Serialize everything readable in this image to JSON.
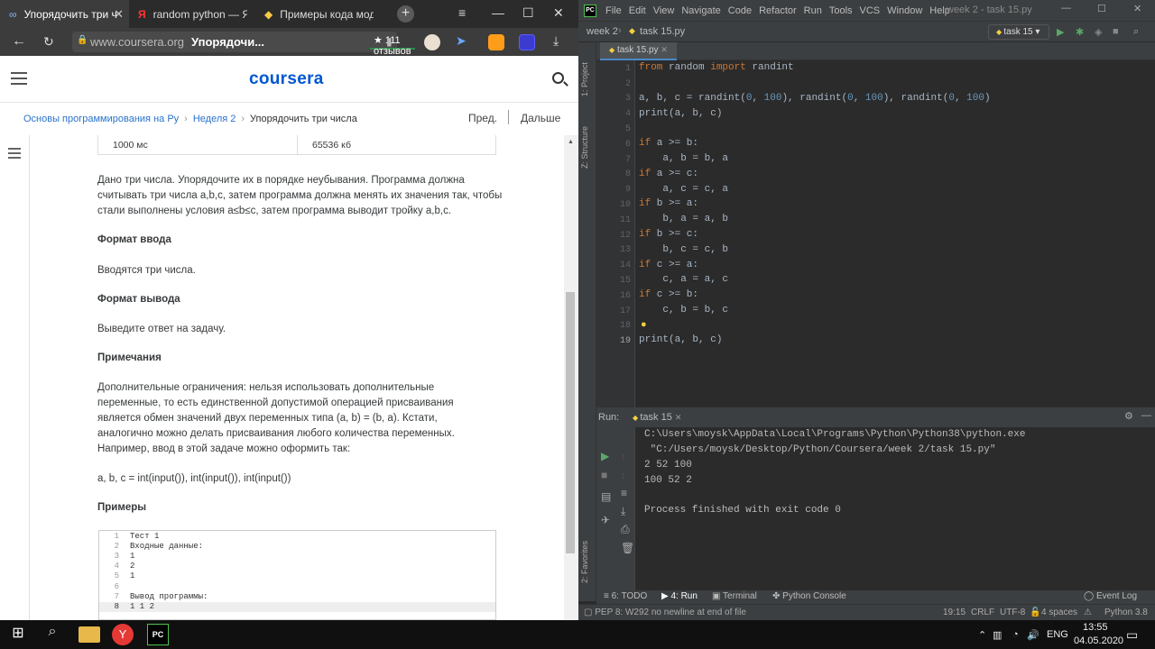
{
  "browser": {
    "tabs": [
      {
        "title": "Упорядочить три ч",
        "icon": "coursera-icon"
      },
      {
        "title": "random python — Янд",
        "icon": "yandex-icon"
      },
      {
        "title": "Примеры кода модул",
        "icon": "python-icon"
      }
    ],
    "address": {
      "host": "www.coursera.org",
      "title": "Упорядочи...",
      "reviews": "★ 111 отзывов"
    }
  },
  "coursera": {
    "logo": "coursera",
    "breadcrumb": [
      "Основы программирования на Ру",
      "Неделя 2",
      "Упорядочить три числа"
    ],
    "prev": "Пред.",
    "next": "Дальше",
    "limits": [
      "1000 мс",
      "65536 кб"
    ],
    "description": "Дано три числа. Упорядочите их в порядке неубывания. Программа должна считывать три числа a,b,c, затем программа должна менять их значения так, чтобы стали выполнены условия a≤b≤c, затем программа выводит тройку a,b,c.",
    "input_heading": "Формат ввода",
    "input_text": "Вводятся три числа.",
    "output_heading": "Формат вывода",
    "output_text": "Выведите ответ на задачу.",
    "notes_heading": "Примечания",
    "notes_text": "Дополнительные ограничения: нельзя использовать дополнительные переменные, то есть единственной допустимой операцией присваивания является обмен значений двух переменных типа (a, b) = (b, a). Кстати, аналогично можно делать присваивания любого количества переменных. Например, ввод в этой задаче можно оформить так:",
    "notes_code": "a, b, c = int(input()), int(input()), int(input())",
    "examples_heading": "Примеры",
    "example_lines": [
      {
        "n": "1",
        "t": "Тест 1"
      },
      {
        "n": "2",
        "t": "Входные данные:"
      },
      {
        "n": "3",
        "t": "1"
      },
      {
        "n": "4",
        "t": "2"
      },
      {
        "n": "5",
        "t": "1"
      },
      {
        "n": "6",
        "t": ""
      },
      {
        "n": "7",
        "t": "Вывод программы:"
      },
      {
        "n": "8",
        "t": "1 1 2"
      }
    ]
  },
  "pycharm": {
    "menu": [
      "File",
      "Edit",
      "View",
      "Navigate",
      "Code",
      "Refactor",
      "Run",
      "Tools",
      "VCS",
      "Window",
      "Help"
    ],
    "window_title": "week 2 - task 15.py",
    "project": "week 2",
    "file": "task 15.py",
    "run_config": "task 15",
    "side_tabs": [
      "1: Project",
      "Z: Structure",
      "2: Favorites"
    ],
    "code_lines": [
      "from random import randint",
      "",
      "a, b, c = randint(0, 100), randint(0, 100), randint(0, 100)",
      "print(a, b, c)",
      "",
      "if a >= b:",
      "    a, b = b, a",
      "if a >= c:",
      "    a, c = c, a",
      "if b >= a:",
      "    b, a = a, b",
      "if b >= c:",
      "    b, c = c, b",
      "if c >= a:",
      "    c, a = a, c",
      "if c >= b:",
      "    c, b = b, c",
      "",
      "print(a, b, c)"
    ],
    "run_label": "Run:",
    "run_tab": "task 15",
    "console": [
      "C:\\Users\\moysk\\AppData\\Local\\Programs\\Python\\Python38\\python.exe",
      " \"C:/Users/moysk/Desktop/Python/Coursera/week 2/task 15.py\"",
      "2 52 100",
      "100 52 2",
      "",
      "Process finished with exit code 0"
    ],
    "bottom_tools": [
      "6: TODO",
      "4: Run",
      "Terminal",
      "Python Console",
      "Event Log"
    ],
    "status": {
      "message": "PEP 8: W292 no newline at end of file",
      "pos": "19:15",
      "eol": "CRLF",
      "enc": "UTF-8",
      "indent": "4 spaces",
      "interp": "Python 3.8"
    }
  },
  "taskbar": {
    "lang": "ENG",
    "time": "13:55",
    "date": "04.05.2020"
  },
  "colors": {
    "coursera_blue": "#0056d2",
    "keyword": "#cc7832",
    "number": "#6897bb"
  }
}
